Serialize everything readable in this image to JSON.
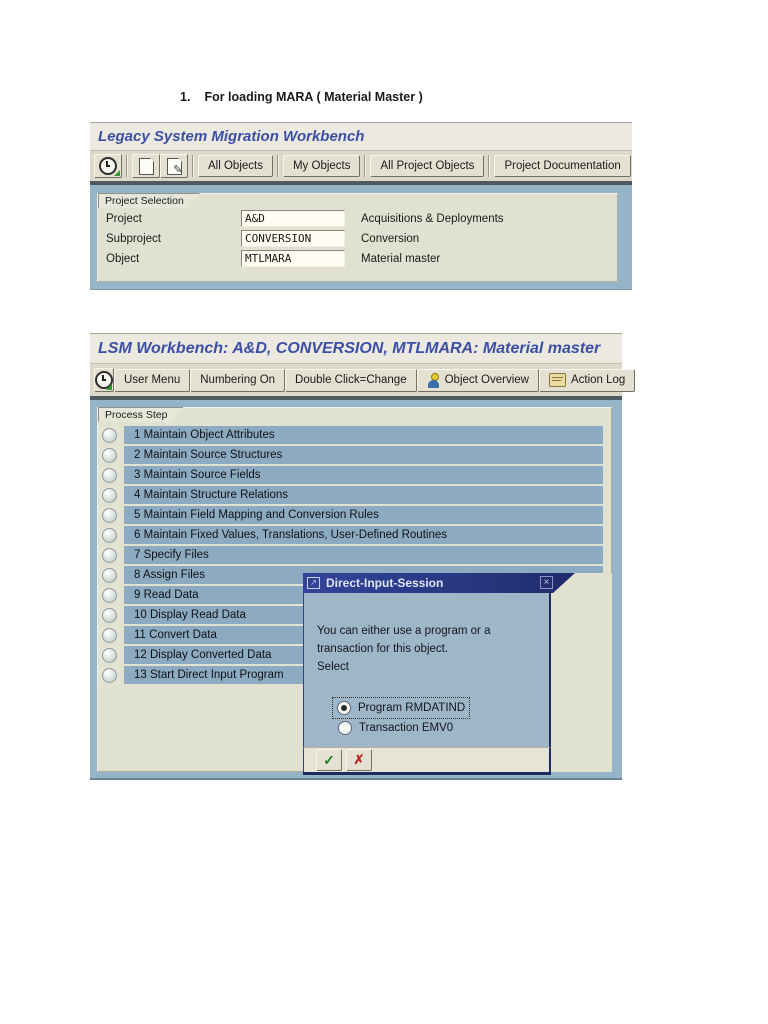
{
  "page": {
    "heading_number": "1.",
    "heading_text": "For loading MARA ( Material Master )"
  },
  "window1": {
    "title": "Legacy System Migration Workbench",
    "toolbar": {
      "buttons": [
        "All Objects",
        "My Objects",
        "All Project Objects",
        "Project Documentation"
      ]
    },
    "panel": {
      "tab_label": "Project Selection",
      "fields": [
        {
          "label": "Project",
          "value": "A&D",
          "description": "Acquisitions & Deployments"
        },
        {
          "label": "Subproject",
          "value": "CONVERSION",
          "description": "Conversion"
        },
        {
          "label": "Object",
          "value": "MTLMARA",
          "description": "Material master"
        }
      ]
    }
  },
  "window2": {
    "title": "LSM Workbench: A&D, CONVERSION, MTLMARA: Material master",
    "toolbar": {
      "buttons": [
        "User Menu",
        "Numbering On",
        "Double Click=Change",
        "Object Overview",
        "Action Log"
      ]
    },
    "panel": {
      "tab_label": "Process Step",
      "steps": [
        "1 Maintain Object Attributes",
        "2 Maintain Source Structures",
        "3 Maintain Source Fields",
        "4 Maintain Structure Relations",
        "5 Maintain Field Mapping and Conversion Rules",
        "6 Maintain Fixed Values, Translations, User-Defined Routines",
        "7 Specify Files",
        "8 Assign Files",
        "9 Read Data",
        "10 Display Read Data",
        "11 Convert Data",
        "12 Display Converted Data",
        "13 Start Direct Input Program"
      ]
    }
  },
  "dialog": {
    "title": "Direct-Input-Session",
    "close_label": "×",
    "icon_glyph": "↗",
    "body_lines": [
      "You can either use a program or a",
      "transaction for this object.",
      "Select"
    ],
    "options": [
      {
        "label": "Program RMDATIND",
        "selected": true
      },
      {
        "label": "Transaction EMV0",
        "selected": false
      }
    ],
    "confirm_glyph": "✓",
    "cancel_glyph": "✗"
  },
  "colors": {
    "title_blue": "#3c4fa5",
    "steel_blue": "#96b4c8",
    "bar_blue": "#8cabc1",
    "panel_beige": "#e1e1d2",
    "dialog_navy": "#27377d",
    "confirm_green": "#1e7d1e",
    "cancel_red": "#c22222"
  }
}
